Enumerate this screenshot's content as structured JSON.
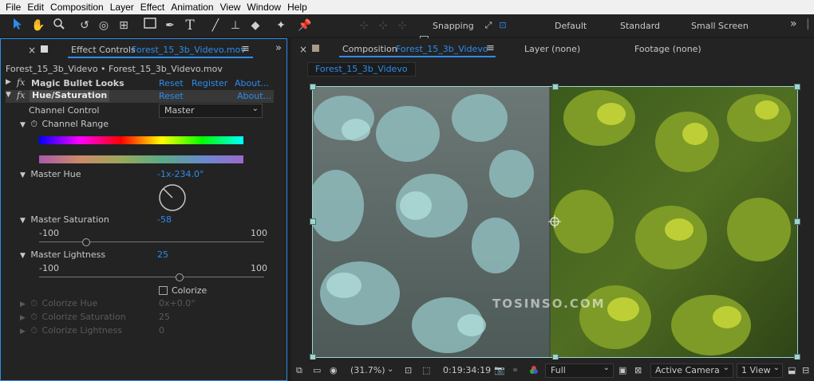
{
  "menu": [
    "File",
    "Edit",
    "Composition",
    "Layer",
    "Effect",
    "Animation",
    "View",
    "Window",
    "Help"
  ],
  "toolbar": {
    "snapping_label": "Snapping",
    "workspaces": [
      "Default",
      "Standard",
      "Small Screen"
    ],
    "more": "»"
  },
  "effect_controls": {
    "tab_prefix": "Effect Controls",
    "tab_layer": "Forest_15_3b_Videvo.mov",
    "menu_icon": "≡",
    "layer_path": "Forest_15_3b_Videvo • Forest_15_3b_Videvo.mov",
    "fx_label": "fx",
    "effects": [
      {
        "name": "Magic Bullet Looks",
        "reset": "Reset",
        "register": "Register",
        "about": "About..."
      },
      {
        "name": "Hue/Saturation",
        "reset": "Reset",
        "about": "About..."
      }
    ],
    "channel_control": {
      "label": "Channel Control",
      "value": "Master"
    },
    "channel_range": "Channel Range",
    "master_hue": {
      "label": "Master Hue",
      "value": "-1x-234.0°"
    },
    "master_saturation": {
      "label": "Master Saturation",
      "value": "-58",
      "min": "-100",
      "max": "100",
      "level": -58
    },
    "master_lightness": {
      "label": "Master Lightness",
      "value": "25",
      "min": "-100",
      "max": "100",
      "level": 25
    },
    "colorize": "Colorize",
    "colorize_hue": {
      "label": "Colorize Hue",
      "value": "0x+0.0°"
    },
    "colorize_saturation": {
      "label": "Colorize Saturation",
      "value": "25"
    },
    "colorize_lightness": {
      "label": "Colorize Lightness",
      "value": "0"
    }
  },
  "composition": {
    "tab_prefix": "Composition",
    "tab_name": "Forest_15_3b_Videvo",
    "menu_icon": "≡",
    "layer_tab": "Layer (none)",
    "footage_tab": "Footage (none)",
    "breadcrumb": "Forest_15_3b_Videvo",
    "watermark": "TOSINSO.COM",
    "zoom": "(31.7%)",
    "timecode": "0:19:34:19",
    "resolution": "Full",
    "camera": "Active Camera",
    "view": "1 View"
  },
  "colors": {
    "accent": "#2d8ceb",
    "panel": "#232323",
    "background": "#1d1d1d"
  }
}
